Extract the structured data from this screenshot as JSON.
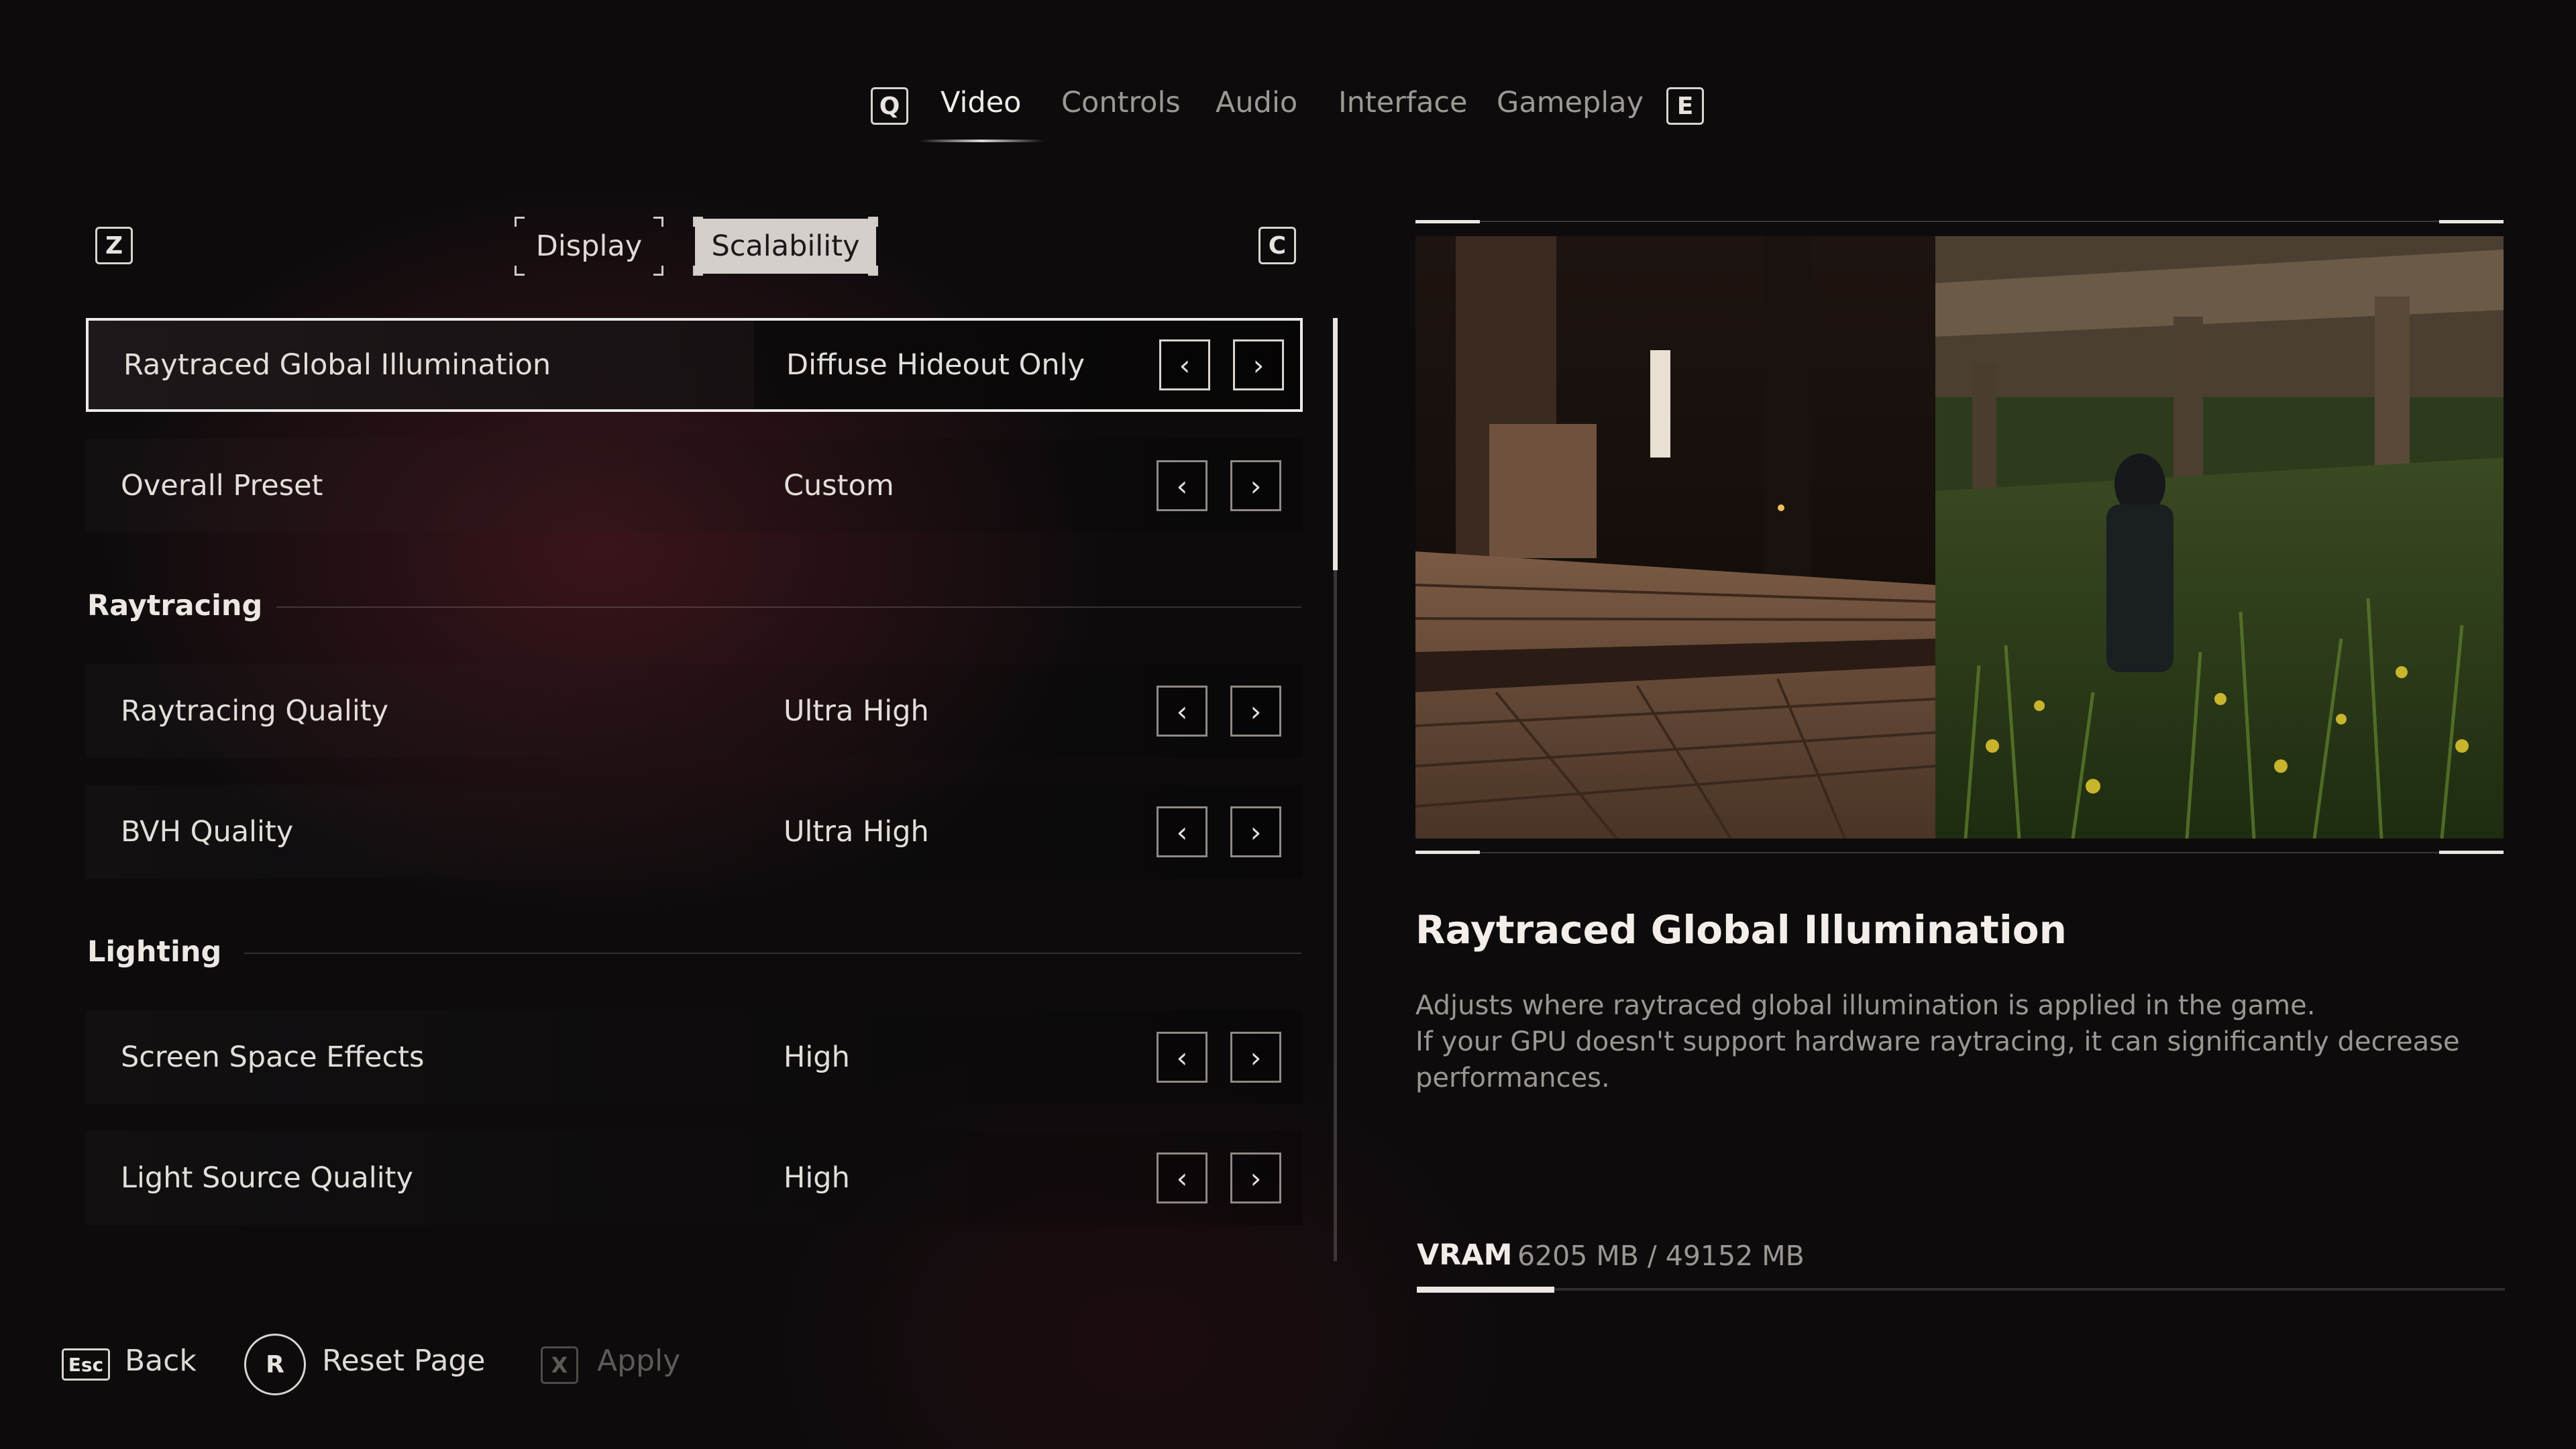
{
  "top_nav": {
    "prev_key": "Q",
    "next_key": "E",
    "tabs": [
      {
        "label": "Video",
        "active": true
      },
      {
        "label": "Controls",
        "active": false
      },
      {
        "label": "Audio",
        "active": false
      },
      {
        "label": "Interface",
        "active": false
      },
      {
        "label": "Gameplay",
        "active": false
      }
    ]
  },
  "sub_nav": {
    "prev_key": "Z",
    "next_key": "C",
    "tabs": [
      {
        "label": "Display",
        "selected": false
      },
      {
        "label": "Scalability",
        "selected": true
      }
    ]
  },
  "settings": {
    "rows": [
      {
        "label": "Raytraced Global Illumination",
        "value": "Diffuse Hideout Only",
        "selected": true
      },
      {
        "label": "Overall Preset",
        "value": "Custom"
      },
      {
        "label": "Raytracing Quality",
        "value": "Ultra High"
      },
      {
        "label": "BVH Quality",
        "value": "Ultra High"
      },
      {
        "label": "Screen Space Effects",
        "value": "High"
      },
      {
        "label": "Light Source Quality",
        "value": "High"
      }
    ],
    "sections": {
      "raytracing": "Raytracing",
      "lighting": "Lighting"
    },
    "arrow_prev": "‹",
    "arrow_next": "›"
  },
  "details": {
    "title": "Raytraced Global Illumination",
    "description_lines": [
      "Adjusts where raytraced global illumination is applied in the game.",
      "If your GPU doesn't support hardware raytracing, it can significantly decrease",
      "performances."
    ],
    "preview_image": "wooden-hideout-porch-and-grass-scene"
  },
  "vram": {
    "label": "VRAM",
    "value_text": "6205 MB / 49152 MB",
    "used_mb": 6205,
    "total_mb": 49152
  },
  "footer": {
    "back": {
      "key": "Esc",
      "label": "Back"
    },
    "reset": {
      "key": "R",
      "label": "Reset Page"
    },
    "apply": {
      "key": "X",
      "label": "Apply",
      "disabled": true
    }
  },
  "colors": {
    "background": "#0d0b0c",
    "accent_glow": "#5f1c26",
    "text_primary": "#f1ece7",
    "text_muted": "#9b9691"
  }
}
